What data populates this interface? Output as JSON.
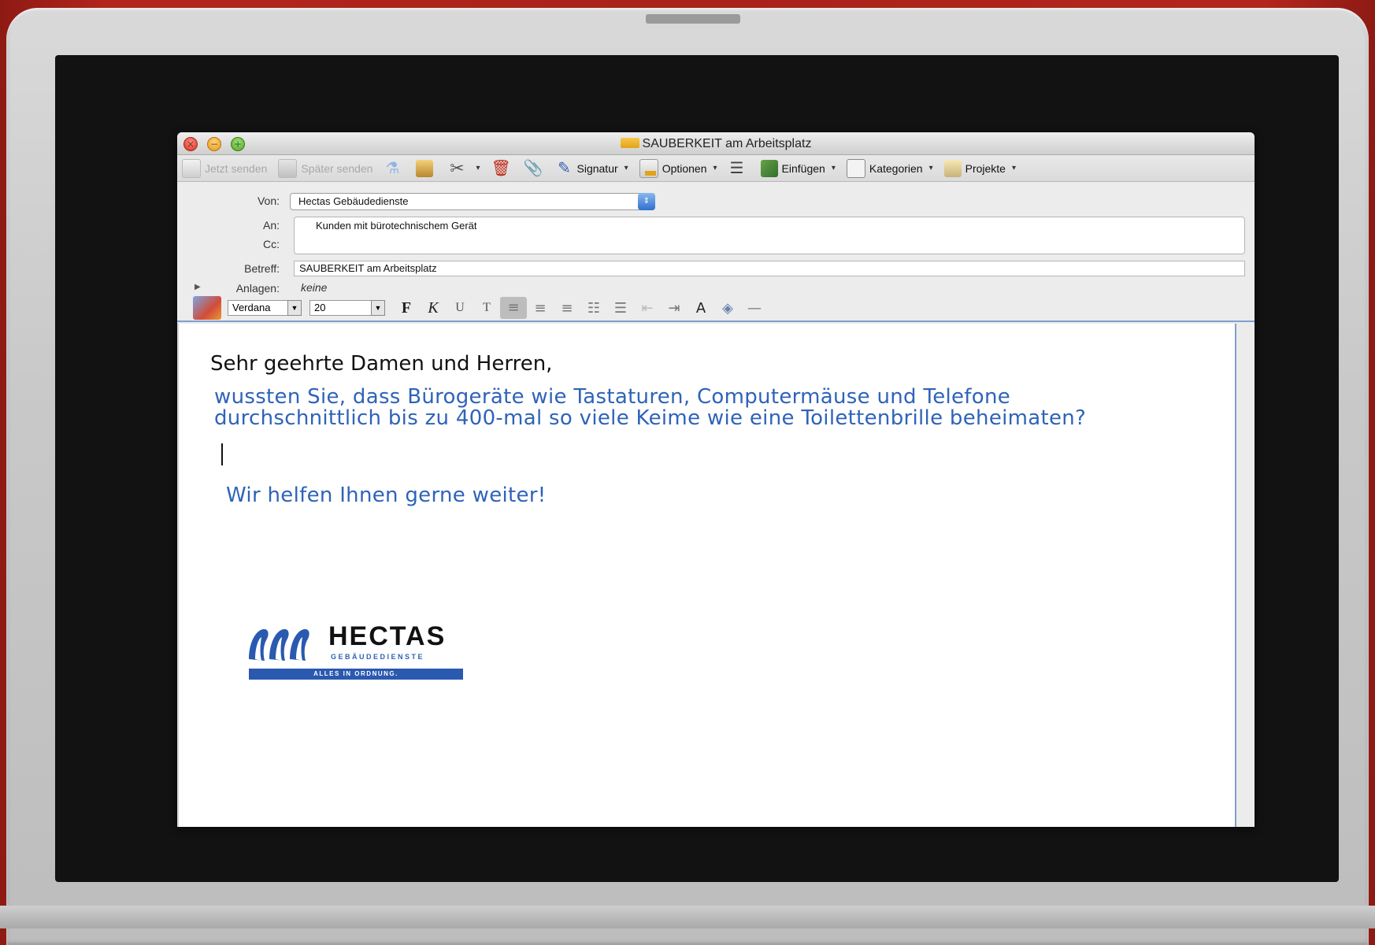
{
  "window": {
    "title": "SAUBERKEIT am Arbeitsplatz"
  },
  "toolbar": {
    "send_now": "Jetzt senden",
    "send_later": "Später senden",
    "signature": "Signatur",
    "options": "Optionen",
    "insert": "Einfügen",
    "categories": "Kategorien",
    "projects": "Projekte"
  },
  "header": {
    "from_label": "Von:",
    "from_value": "Hectas Gebäudedienste",
    "to_label": "An:",
    "to_value": "Kunden mit bürotechnischem Gerät",
    "cc_label": "Cc:",
    "subject_label": "Betreff:",
    "subject_value": "SAUBERKEIT am Arbeitsplatz",
    "attachments_label": "Anlagen:",
    "attachments_value": "keine"
  },
  "format": {
    "font": "Verdana",
    "size": "20",
    "bold": "F",
    "italic": "K",
    "underline": "U",
    "strike": "T"
  },
  "body": {
    "greeting": "Sehr geehrte Damen und Herren,",
    "line1": "wussten Sie, dass Bürogeräte wie Tastaturen, Computermäuse und Telefone",
    "line2": "durchschnittlich bis zu 400-mal so viele Keime wie eine Toilettenbrille beheimaten?",
    "closing": "Wir helfen Ihnen gerne weiter!"
  },
  "logo": {
    "name": "HECTAS",
    "sub": "GEBÄUDEDIENSTE",
    "tagline": "ALLES IN ORDNUNG."
  },
  "colors": {
    "body_text": "#2f63b8",
    "accent": "#2a59b0"
  }
}
